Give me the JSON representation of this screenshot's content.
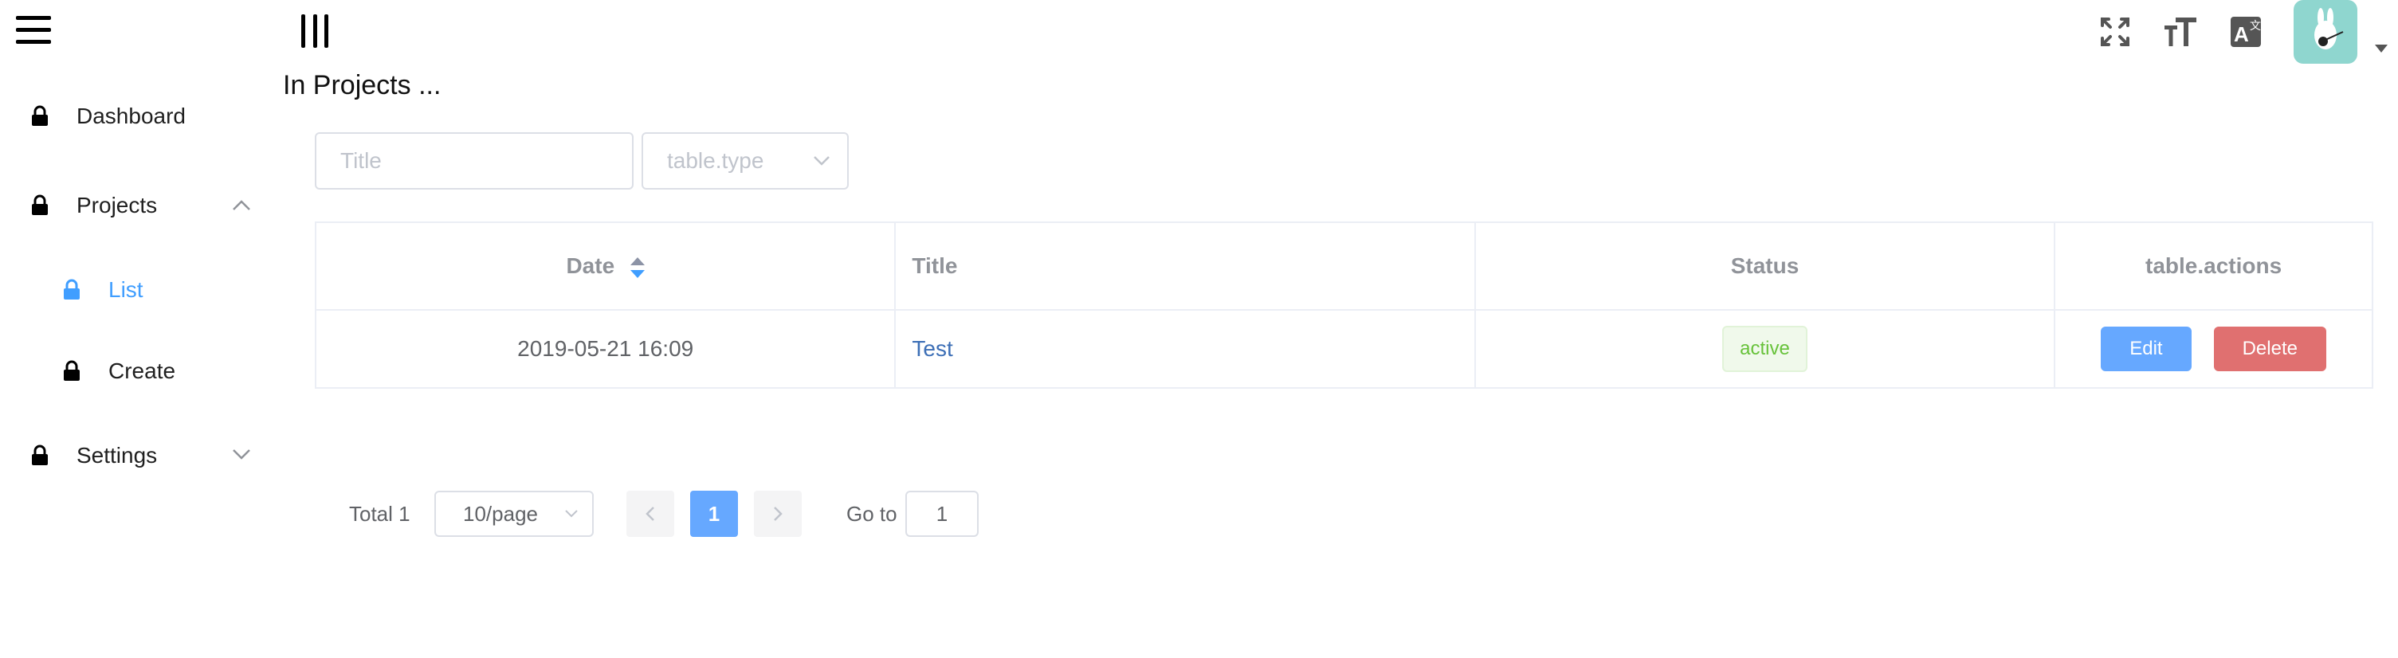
{
  "sidebar": {
    "items": [
      {
        "label": "Dashboard"
      },
      {
        "label": "Projects"
      },
      {
        "label": "List"
      },
      {
        "label": "Create"
      },
      {
        "label": "Settings"
      }
    ]
  },
  "header": {
    "page_title": "In Projects ...",
    "icons": [
      "fullscreen-icon",
      "font-size-icon",
      "translate-icon",
      "user-avatar"
    ]
  },
  "filters": {
    "title_placeholder": "Title",
    "type_placeholder": "table.type"
  },
  "table": {
    "columns": [
      "Date",
      "Title",
      "Status",
      "table.actions"
    ],
    "rows": [
      {
        "date": "2019-05-21 16:09",
        "title": "Test",
        "status": "active",
        "edit": "Edit",
        "delete": "Delete"
      }
    ]
  },
  "pagination": {
    "total_label": "Total 1",
    "page_size": "10/page",
    "current_page": "1",
    "goto_label": "Go to",
    "goto_value": "1"
  },
  "colors": {
    "accent": "#409eff",
    "danger": "#e07070",
    "success": "#67c23a",
    "avatar_bg": "#8fd6cf"
  }
}
